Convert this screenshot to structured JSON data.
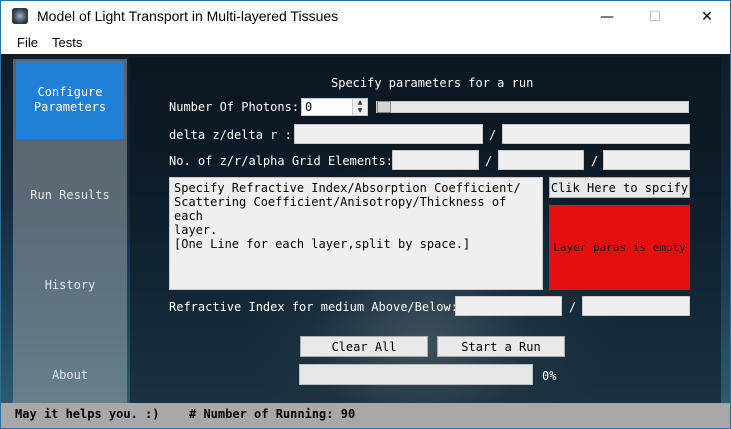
{
  "window": {
    "title": "Model of Light Transport in Multi-layered Tissues",
    "controls": {
      "minimize": "—",
      "maximize": "☐",
      "close": "✕"
    }
  },
  "menu": [
    "File",
    "Tests"
  ],
  "sidebar": {
    "items": [
      {
        "label_line1": "Configure",
        "label_line2": "Parameters",
        "active": true
      },
      {
        "label": "Run Results"
      },
      {
        "label": "History"
      },
      {
        "label": "About"
      }
    ]
  },
  "form": {
    "heading": "Specify parameters for a run",
    "photons_label": "Number Of Photons:",
    "photons_value": "0",
    "photons_slider_value": 0,
    "delta_label": "delta z/delta r :",
    "delta_sep": "/",
    "delta_values": [
      "",
      ""
    ],
    "grid_label": "No. of z/r/alpha Grid Elements:",
    "grid_sep": "/",
    "grid_values": [
      "",
      "",
      ""
    ],
    "layers_text": "Specify Refractive Index/Absorption Coefficient/\nScattering Coefficient/Anisotropy/Thickness of each\nlayer.\n[One Line for each layer,split by space.]",
    "specify_button": "Clik Here to spcify",
    "layer_status": "Layer paras is empty",
    "layer_status_color": "#e50f0f",
    "medium_label": "Refractive Index for medium Above/Below:",
    "medium_sep": "/",
    "medium_values": [
      "",
      ""
    ],
    "clear_button": "Clear All",
    "start_button": "Start a Run",
    "progress_value": 0,
    "progress_text": "0%"
  },
  "status": {
    "left": "May it helps you. :)",
    "right": "# Number of Running: 90"
  }
}
